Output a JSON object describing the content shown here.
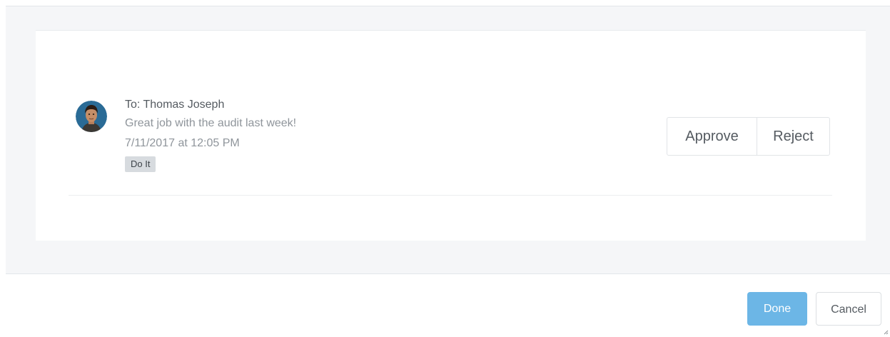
{
  "notification": {
    "recipient": "To: Thomas Joseph",
    "message": "Great job with the audit last week!",
    "timestamp": "7/11/2017 at 12:05 PM",
    "tag": "Do It",
    "actions": {
      "approve_label": "Approve",
      "reject_label": "Reject"
    }
  },
  "footer": {
    "done_label": "Done",
    "cancel_label": "Cancel"
  },
  "colors": {
    "primary": "#6cb6e6",
    "panel_background": "#f5f6f8",
    "tag_background": "#d7dbdf"
  },
  "icons": {
    "avatar": "user-avatar-photo",
    "resize": "resize-grip-icon"
  }
}
